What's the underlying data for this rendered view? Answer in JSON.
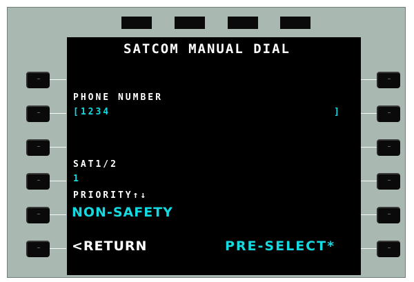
{
  "screen": {
    "title": "SATCOM MANUAL DIAL",
    "phone_label": "PHONE NUMBER",
    "phone_open": "[1234",
    "phone_close": "]",
    "sat_label": "SAT1/2",
    "sat_value": "1",
    "priority_label": "PRIORITY↑↓",
    "priority_value": "NON-SAFETY",
    "return_label": "<RETURN",
    "preselect_label": "PRE-SELECT*"
  },
  "keys": {
    "lsk_glyph": "–"
  },
  "colors": {
    "bezel": "#a9b9b2",
    "screen": "#000000",
    "label": "#ffffff",
    "data": "#14d9e0"
  }
}
